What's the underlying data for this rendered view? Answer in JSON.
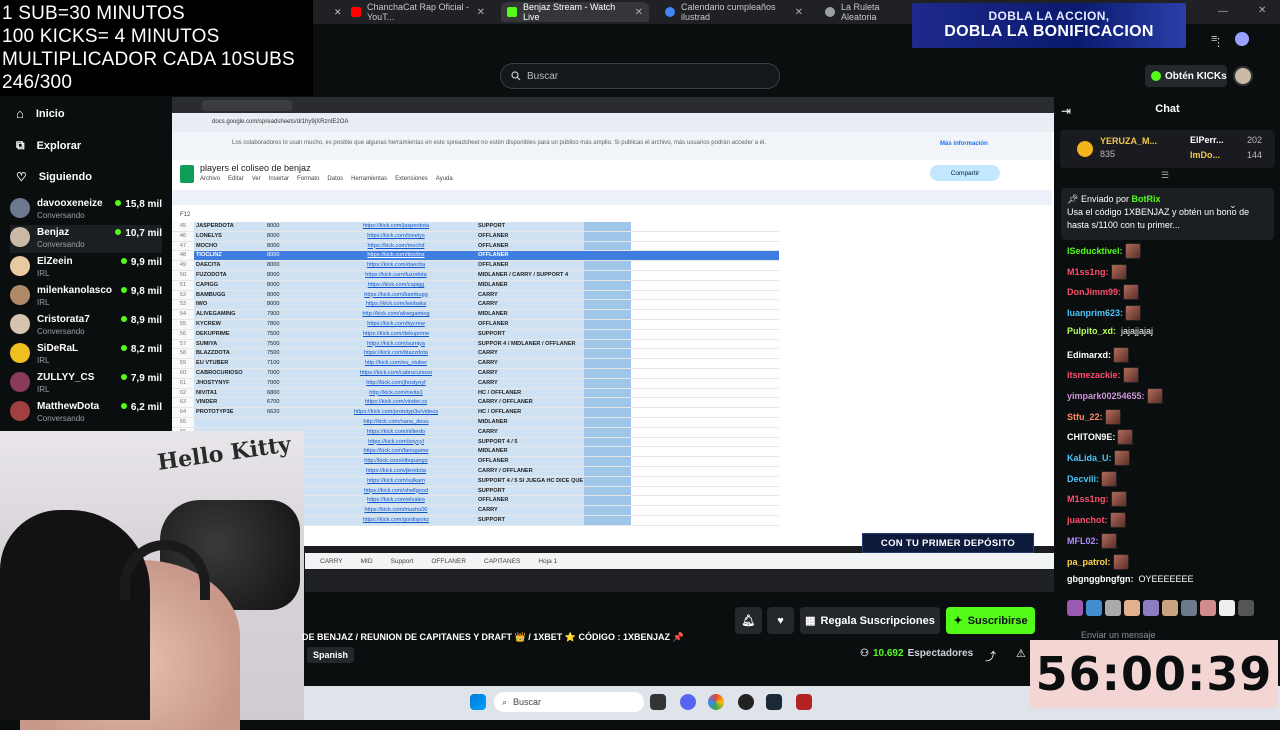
{
  "browser": {
    "tabs": [
      {
        "label": "ChanchaCat Rap Oficial - YouT...",
        "icon": "youtube-icon",
        "color": "#ff0000"
      },
      {
        "label": "Benjaz Stream - Watch Live",
        "icon": "kick-icon",
        "color": "#53fc18",
        "active": true
      },
      {
        "label": "Calendario cumpleaños ilustrad",
        "icon": "globe-icon",
        "color": "#4285f4"
      },
      {
        "label": "La Ruleta Aleatoria",
        "icon": "globe-icon",
        "color": "#9aa0a6"
      }
    ]
  },
  "overlay": {
    "line1": "1 SUB=30 MINUTOS",
    "line2": "100 KICKS= 4 MINUTOS",
    "line3": "MULTIPLICADOR CADA 10SUBS",
    "line4": "246/300"
  },
  "promo_top": {
    "line1": "DOBLA LA ACCION,",
    "line2": "DOBLA LA BONIFICACION"
  },
  "header": {
    "search_placeholder": "Buscar",
    "kicks_label": "Obtén KICKs"
  },
  "sidebar": {
    "nav": [
      {
        "label": "Inicio",
        "icon": "home-icon"
      },
      {
        "label": "Explorar",
        "icon": "compass-icon"
      },
      {
        "label": "Siguiendo",
        "icon": "heart-icon"
      }
    ],
    "channels": [
      {
        "name": "davooxeneize",
        "category": "Conversando",
        "viewers": "15,8 mil",
        "color": "#6b7a8f"
      },
      {
        "name": "Benjaz",
        "category": "Conversando",
        "viewers": "10,7 mil",
        "color": "#c9b9a6"
      },
      {
        "name": "ElZeein",
        "category": "IRL",
        "viewers": "9,9 mil",
        "color": "#e8c9a0"
      },
      {
        "name": "milenkanolasco",
        "category": "IRL",
        "viewers": "9,8 mil",
        "color": "#b08968"
      },
      {
        "name": "Cristorata7",
        "category": "Conversando",
        "viewers": "8,9 mil",
        "color": "#d4c4b0"
      },
      {
        "name": "SiDeRaL",
        "category": "IRL",
        "viewers": "8,2 mil",
        "color": "#f0c020"
      },
      {
        "name": "ZULLYY_CS",
        "category": "IRL",
        "viewers": "7,9 mil",
        "color": "#8a3a5a"
      },
      {
        "name": "MatthewDota",
        "category": "Conversando",
        "viewers": "6,2 mil",
        "color": "#a04040"
      }
    ]
  },
  "sheet": {
    "url": "docs.google.com/spreadsheets/d/1hy9jXRznIE2OA",
    "info": "Los colaboradores lo usan mucho, es posible que algunas herramientas en este spreadsheet no estén disponibles para un público más amplio. Si publicas el archivo, más usuarios podrán acceder a él.",
    "info_link": "Más información",
    "title": "players el coliseo de benjaz",
    "menu": [
      "Archivo",
      "Editar",
      "Ver",
      "Insertar",
      "Formato",
      "Datos",
      "Herramientas",
      "Extensiones",
      "Ayuda"
    ],
    "share": "Compartir",
    "cell_ref": "F12",
    "rows": [
      {
        "n": "45",
        "name": "JASPERDOTA",
        "mmr": "8000",
        "link": "https://kick.com/jasperdota",
        "role": "SUPPORT"
      },
      {
        "n": "46",
        "name": "LONELYS",
        "mmr": "8000",
        "link": "https://kick.com/lonelys",
        "role": "OFFLANER"
      },
      {
        "n": "47",
        "name": "MOCHO",
        "mmr": "8000",
        "link": "https://kick.com/mochd",
        "role": "OFFLANER"
      },
      {
        "n": "48",
        "name": "TIOCLINZ",
        "mmr": "8000",
        "link": "https://kick.com/tioclinz",
        "role": "OFFLANER",
        "selected": true
      },
      {
        "n": "49",
        "name": "DAECITA",
        "mmr": "8000",
        "link": "https://kick.com/daecita",
        "role": "OFFLANER"
      },
      {
        "n": "50",
        "name": "FUZODOTA",
        "mmr": "8000",
        "link": "https://kick.com/fuzodota",
        "role": "MIDLANER / CARRY / SUPPORT 4"
      },
      {
        "n": "51",
        "name": "CAPIGG",
        "mmr": "8000",
        "link": "https://kick.com/capigg",
        "role": "MIDLANER"
      },
      {
        "n": "52",
        "name": "BAMBUGG",
        "mmr": "8000",
        "link": "https://kick.com/bambugg",
        "role": "CARRY"
      },
      {
        "n": "53",
        "name": "IWO",
        "mmr": "8000",
        "link": "https://kick.com/iwobaka",
        "role": "CARRY"
      },
      {
        "n": "54",
        "name": "ALIVEGAMING",
        "mmr": "7900",
        "link": "http://kick.com/alivegaming",
        "role": "MIDLANER"
      },
      {
        "n": "55",
        "name": "KYCREW",
        "mmr": "7800",
        "link": "https://kick.com/kycrew",
        "role": "OFFLANER"
      },
      {
        "n": "56",
        "name": "DEKUPRIME",
        "mmr": "7500",
        "link": "https://kick.com/dekuprime",
        "role": "SUPPORT"
      },
      {
        "n": "57",
        "name": "SUMIYA",
        "mmr": "7500",
        "link": "https://kick.com/sumiya",
        "role": "SUPPOR 4 / MIDLANER / OFFLANER"
      },
      {
        "n": "58",
        "name": "BLAZZDOTA",
        "mmr": "7500",
        "link": "https://kick.com/blazzdota",
        "role": "CARRY"
      },
      {
        "n": "59",
        "name": "EU VTUBER",
        "mmr": "7100",
        "link": "http://kick.com/eu_vtuber",
        "role": "CARRY"
      },
      {
        "n": "60",
        "name": "CABROCURIOSO",
        "mmr": "7000",
        "link": "https://kick.com/cabrocurioso",
        "role": "CARRY"
      },
      {
        "n": "61",
        "name": "JHOSTYNYF",
        "mmr": "7000",
        "link": "http://kick.com/jhostynyf",
        "role": "CARRY"
      },
      {
        "n": "62",
        "name": "NIVITA1",
        "mmr": "6800",
        "link": "http://kick.com/nivita1",
        "role": "HC / OFFLANER"
      },
      {
        "n": "63",
        "name": "VINDER",
        "mmr": "6700",
        "link": "https://kick.com/vinder.cs",
        "role": "CARRY / OFFLANER"
      },
      {
        "n": "64",
        "name": "PROTOTYP3E",
        "mmr": "6620",
        "link": "https://kick.com/prototyp3e/videos",
        "role": "HC / OFFLANER"
      },
      {
        "n": "65",
        "name": "",
        "mmr": "",
        "link": "http://kick.com/nana_deuu",
        "role": "MIDLANER"
      },
      {
        "n": "66",
        "name": "",
        "mmr": "",
        "link": "https://kick.com/nillerdo",
        "role": "CARRY"
      },
      {
        "n": "67",
        "name": "",
        "mmr": "",
        "link": "https://kick.com/soycyl",
        "role": "SUPPORT 4 / 5"
      },
      {
        "n": "68",
        "name": "",
        "mmr": "",
        "link": "https://kick.com/fanogame",
        "role": "MIDLANER"
      },
      {
        "n": "69",
        "name": "",
        "mmr": "",
        "link": "http://kick.com/elbopango",
        "role": "OFFLANER"
      },
      {
        "n": "70",
        "name": "",
        "mmr": "",
        "link": "https://kick.com/jkredota",
        "role": "CARRY / OFFLANER"
      },
      {
        "n": "71",
        "name": "",
        "mmr": "",
        "link": "https://kick.com/sulkam",
        "role": "SUPPORT 4 / 5 SI JUEGA HC DICE QUE ES 3K"
      },
      {
        "n": "72",
        "name": "",
        "mmr": "",
        "link": "https://kick.com/shellgood",
        "role": "SUPPORT"
      },
      {
        "n": "73",
        "name": "",
        "mmr": "",
        "link": "https://kick.com/elvaleo",
        "role": "OFFLANER"
      },
      {
        "n": "74",
        "name": "",
        "mmr": "",
        "link": "https://kick.com/mushu00",
        "role": "CARRY"
      },
      {
        "n": "75",
        "name": "",
        "mmr": "",
        "link": "https://kick.com/gordopokz",
        "role": "SUPPORT"
      }
    ],
    "sheet_tabs": [
      "CARRY",
      "MID",
      "Support",
      "OFFLANER",
      "CAPITANES",
      "Hoja 1"
    ]
  },
  "promo_deposit": "CON TU PRIMER DEPÓSITO",
  "webcam": {
    "wall_text": "Hello Kitty"
  },
  "stream": {
    "title": "DE BENJAZ / REUNION DE CAPITANES Y DRAFT 👑 / 1XBET ⭐ CÓDIGO : 1XBENJAZ 📌",
    "language": "Spanish",
    "viewers": "10.692",
    "viewers_label": "Espectadores",
    "gift_label": "Regala Suscripciones",
    "subscribe_label": "Suscribirse"
  },
  "taskbar": {
    "search_placeholder": "Buscar"
  },
  "chat": {
    "title": "Chat",
    "leaderboard": [
      {
        "name": "YERUZA_M...",
        "count": "835"
      },
      {
        "name": "ElPerr...",
        "count": "202"
      },
      {
        "name": "ImDo...",
        "count": "144"
      }
    ],
    "pinned_by_label": "Enviado por",
    "pinned_by": "BotRix",
    "pinned_text": "Usa el código 1XBENJAZ y obtén un bono de hasta s/1100 con tu primer...",
    "messages": [
      {
        "user": "lSeducktivel:",
        "color": "#53fc18",
        "text": ""
      },
      {
        "user": "M1ss1ng:",
        "color": "#ff4d6d",
        "text": ""
      },
      {
        "user": "DonJimm99:",
        "color": "#ff4d6d",
        "text": ""
      },
      {
        "user": "luanprim623:",
        "color": "#4fc3f7",
        "text": ""
      },
      {
        "user": "Pulpito_xd:",
        "color": "#b2ff59",
        "text": "jajajjajaj"
      },
      {
        "user": "Edimarxd:",
        "color": "#ffffff",
        "text": ""
      },
      {
        "user": "itsmezackie:",
        "color": "#ff4d6d",
        "text": ""
      },
      {
        "user": "yimpark00254655:",
        "color": "#ce93d8",
        "text": ""
      },
      {
        "user": "Stfu_22:",
        "color": "#ff8a65",
        "text": ""
      },
      {
        "user": "CHITON9E:",
        "color": "#ffffff",
        "text": ""
      },
      {
        "user": "KaLida_U:",
        "color": "#4fc3f7",
        "text": ""
      },
      {
        "user": "Decvili:",
        "color": "#4fc3f7",
        "text": ""
      },
      {
        "user": "M1ss1ng:",
        "color": "#ff4d6d",
        "text": ""
      },
      {
        "user": "juanchot:",
        "color": "#ff4d6d",
        "text": ""
      },
      {
        "user": "MFL02:",
        "color": "#b388ff",
        "text": ""
      },
      {
        "user": "pa_patrol:",
        "color": "#ffd54f",
        "text": ""
      },
      {
        "user": "gbgnggbngfgn:",
        "color": "#ffffff",
        "text": "OYEEEEEEE"
      }
    ],
    "input_placeholder": "Enviar un mensaje"
  },
  "timer": "56:00:39"
}
